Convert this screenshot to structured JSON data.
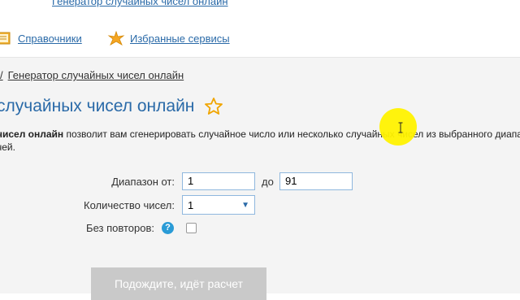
{
  "top": {
    "link": "Генератор случайных чисел онлайн"
  },
  "nav": [
    {
      "label": "Справочники",
      "icon": "book-icon"
    },
    {
      "label": "Избранные сервисы",
      "icon": "star-burst-icon"
    }
  ],
  "breadcrumb": {
    "prefix": "/",
    "separator": "/",
    "current": "Генератор случайных чисел онлайн"
  },
  "page": {
    "title": "случайных чисел онлайн",
    "intro_bold": "чисел онлайн",
    "intro_text": " позволит вам сгенерировать случайное число или несколько случайных чисел из выбранного диапа",
    "intro_line2": "чей."
  },
  "form": {
    "range_label": "Диапазон от:",
    "from_value": "1",
    "to_label": "до",
    "to_value": "91",
    "count_label": "Количество чисел:",
    "count_value": "1",
    "norepeat_label": "Без повторов:",
    "help_symbol": "?",
    "norepeat_checked": false
  },
  "button": {
    "label": "Подождите, идёт расчет"
  },
  "colors": {
    "link": "#2a6aa8",
    "highlight": "#fff200",
    "button_disabled": "#c9c9c9",
    "help": "#2a9bd6"
  }
}
